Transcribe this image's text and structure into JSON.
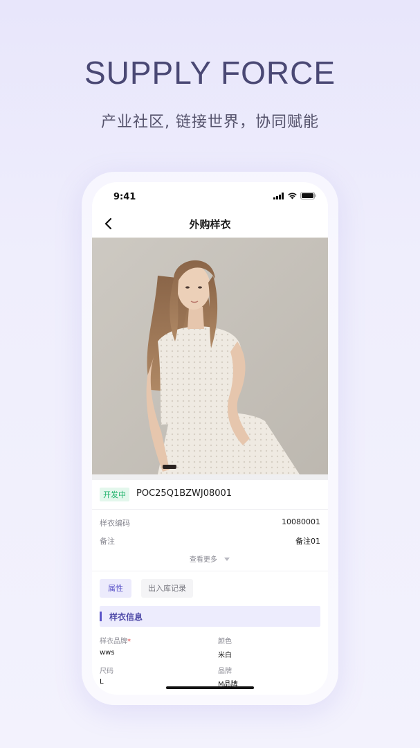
{
  "hero": {
    "title": "SUPPLY FORCE",
    "subtitle": "产业社区, 链接世界，协同赋能"
  },
  "status_bar": {
    "time": "9:41",
    "icons": [
      "signal-icon",
      "wifi-icon",
      "battery-icon"
    ]
  },
  "nav": {
    "back_icon": "chevron-left-icon",
    "title": "外购样衣"
  },
  "product": {
    "status_badge": "开发中",
    "code": "POC25Q1BZWJ08001",
    "rows": [
      {
        "label": "样衣编码",
        "value": "10080001"
      },
      {
        "label": "备注",
        "value": "备注01"
      }
    ],
    "more_label": "查看更多"
  },
  "tabs": [
    {
      "label": "属性",
      "active": true
    },
    {
      "label": "出入库记录",
      "active": false
    }
  ],
  "section": {
    "title": "样衣信息",
    "fields": [
      {
        "label": "样衣品牌",
        "required": "*",
        "value": "wws"
      },
      {
        "label": "颜色",
        "value": "米白"
      },
      {
        "label": "尺码",
        "value": "L"
      },
      {
        "label": "品牌",
        "value": "M品牌"
      }
    ]
  },
  "colors": {
    "accent": "#5b54c8",
    "status_green": "#1fb26b",
    "hero_text": "#4a4874"
  }
}
